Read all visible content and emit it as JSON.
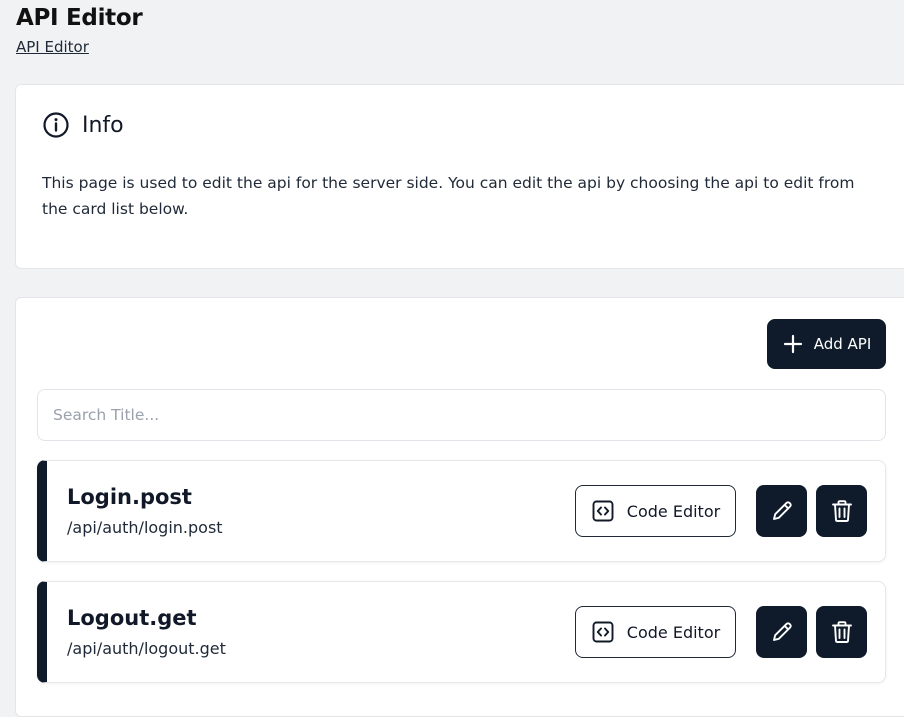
{
  "header": {
    "title": "API Editor",
    "breadcrumb": "API Editor"
  },
  "info": {
    "icon": "info-circle-icon",
    "title": "Info",
    "description": "This page is used to edit the api for the server side. You can edit the api by choosing the api to edit from the card list below."
  },
  "toolbar": {
    "add_label": "Add API",
    "add_icon": "plus-icon"
  },
  "search": {
    "placeholder": "Search Title...",
    "value": ""
  },
  "apis": [
    {
      "name": "Login.post",
      "path": "/api/auth/login.post",
      "code_editor_label": "Code Editor"
    },
    {
      "name": "Logout.get",
      "path": "/api/auth/logout.get",
      "code_editor_label": "Code Editor"
    }
  ],
  "colors": {
    "accent": "#0f1b2a",
    "background": "#f1f2f4",
    "card": "#ffffff"
  }
}
